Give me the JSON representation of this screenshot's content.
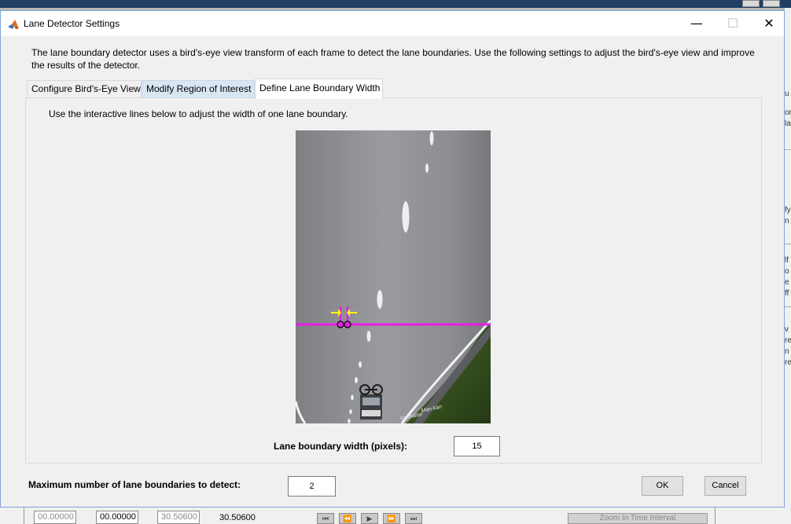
{
  "window": {
    "title": "Lane Detector Settings",
    "controls": [
      "—",
      "☐",
      "✕"
    ],
    "icon": "matlab-logo-icon"
  },
  "intro_text": "The lane boundary detector uses a bird's-eye view transform of each frame to detect the lane boundaries. Use the following settings to adjust the bird's-eye view and improve the results of the detector.",
  "tabs": [
    {
      "label": "Configure Bird's-Eye View",
      "state": "normal"
    },
    {
      "label": "Modify Region of Interest",
      "state": "hover"
    },
    {
      "label": "Define Lane Boundary Width",
      "state": "selected"
    }
  ],
  "panel": {
    "instruction": "Use the interactive lines below to adjust the width of one lane boundary.",
    "image_caption_graffiti": [
      "Man kan",
      "Vanhaltar"
    ],
    "width_label": "Lane boundary width (pixels):",
    "width_value": "15"
  },
  "footer": {
    "max_label": "Maximum number of lane boundaries to detect:",
    "max_value": "2",
    "ok_label": "OK",
    "cancel_label": "Cancel"
  },
  "background": {
    "time_fields": [
      "00.00000",
      "00.00000",
      "30.50600"
    ],
    "time_plain": "30.50600",
    "zoom_label": "Zoom In Time Interval",
    "side_fragments": [
      "u",
      "or",
      "la",
      "fy",
      "n",
      "lf",
      "o",
      "e",
      "ff",
      "v",
      "re",
      "n",
      "re"
    ]
  },
  "colors": {
    "accent_magenta": "#e61fe6",
    "arrow_yellow": "#ffff00",
    "dialog_bg": "#f0f0f0",
    "titlebar_bg": "#ffffff",
    "tab_hover": "#d8e6f2"
  }
}
